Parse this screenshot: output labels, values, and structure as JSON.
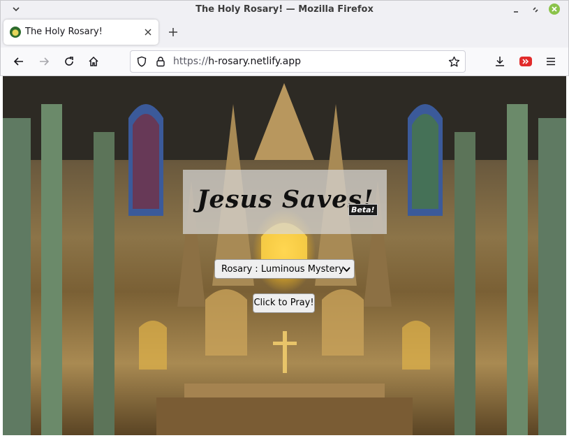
{
  "window": {
    "title": "The Holy Rosary! — Mozilla Firefox"
  },
  "tabs": [
    {
      "label": "The Holy Rosary!"
    }
  ],
  "urlbar": {
    "protocol": "https://",
    "host": "h-rosary.netlify.app"
  },
  "page": {
    "heading": "Jesus Saves!",
    "badge": "Beta!",
    "rosary_select": {
      "selected": "Rosary : Luminous Mystery"
    },
    "pray_button": "Click to Pray!"
  },
  "colors": {
    "window_close": "#8bc34a",
    "extension_icon": "#e12b2b",
    "title_panel": "rgba(215,215,215,0.72)"
  },
  "icons": [
    "window-menu-icon",
    "minimize-icon",
    "maximize-icon",
    "close-icon",
    "favicon",
    "tab-close-icon",
    "new-tab-icon",
    "back-icon",
    "forward-icon",
    "reload-icon",
    "home-icon",
    "shield-icon",
    "lock-icon",
    "bookmark-star-icon",
    "download-icon",
    "extension-icon",
    "hamburger-menu-icon",
    "chevron-down-icon"
  ]
}
